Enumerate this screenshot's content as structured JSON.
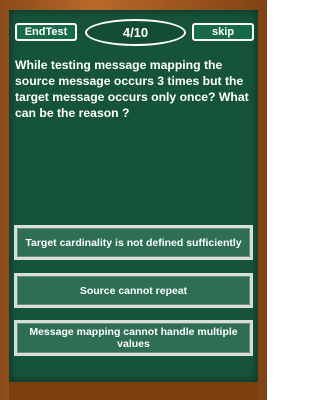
{
  "header": {
    "end_test_label": "EndTest",
    "progress_text": "4/10",
    "skip_label": "skip"
  },
  "question": {
    "text": "While testing message mapping the source message occurs 3 times but the target message occurs only once? What can be the reason ?"
  },
  "answers": [
    {
      "label": "Target cardinality is not defined sufficiently"
    },
    {
      "label": "Source cannot repeat"
    },
    {
      "label": "Message mapping cannot handle multiple values"
    }
  ],
  "colors": {
    "board": "#16543a",
    "frame": "#a0571f",
    "answer_bg": "#2d6e55",
    "text": "#ffffff"
  }
}
